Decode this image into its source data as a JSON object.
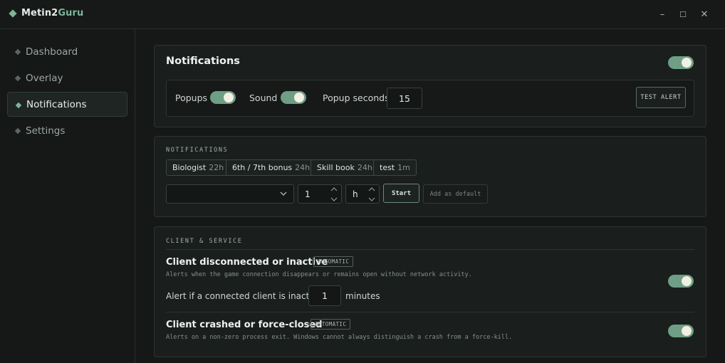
{
  "app": {
    "title_main": "Metin2",
    "title_accent": "Guru"
  },
  "window_controls": {
    "minimize": "–",
    "maximize": "☐",
    "close": "✕"
  },
  "sidebar": {
    "items": [
      {
        "label": "Dashboard"
      },
      {
        "label": "Overlay"
      },
      {
        "label": "Notifications"
      },
      {
        "label": "Settings"
      }
    ],
    "active": "Notifications"
  },
  "notifications_card": {
    "title": "Notifications",
    "enabled": true,
    "popups_label": "Popups",
    "popups_enabled": true,
    "sound_label": "Sound",
    "sound_enabled": true,
    "popup_seconds_label": "Popup seconds",
    "popup_seconds_value": "15",
    "test_alert_label": "TEST ALERT"
  },
  "timers_card": {
    "section_label": "NOTIFICATIONS",
    "chips": [
      {
        "name": "Biologist",
        "duration": "22h"
      },
      {
        "name": "6th / 7th bonus",
        "duration": "24h"
      },
      {
        "name": "Skill book",
        "duration": "24h"
      },
      {
        "name": "test",
        "duration": "1m"
      }
    ],
    "select_value": "",
    "amount_value": "1",
    "unit_value": "h",
    "start_label": "Start",
    "add_default_label": "Add as default"
  },
  "client_card": {
    "section_label": "CLIENT & SERVICE",
    "items": [
      {
        "title": "Client disconnected or inactive",
        "badge": "AUTOMATIC",
        "description": "Alerts when the game connection disappears or remains open without network activity.",
        "enabled": true,
        "inactive_label": "Alert if a connected client is inactive for:",
        "inactive_value": "1",
        "inactive_unit": "minutes"
      },
      {
        "title": "Client crashed or force-closed",
        "badge": "AUTOMATIC",
        "description": "Alerts on a non-zero process exit. Windows cannot always distinguish a crash from a force-kill.",
        "enabled": true
      }
    ]
  },
  "colors": {
    "accent": "#7fb49a",
    "toggle_on": "#6f9e86",
    "knob": "#f1f0e2"
  }
}
